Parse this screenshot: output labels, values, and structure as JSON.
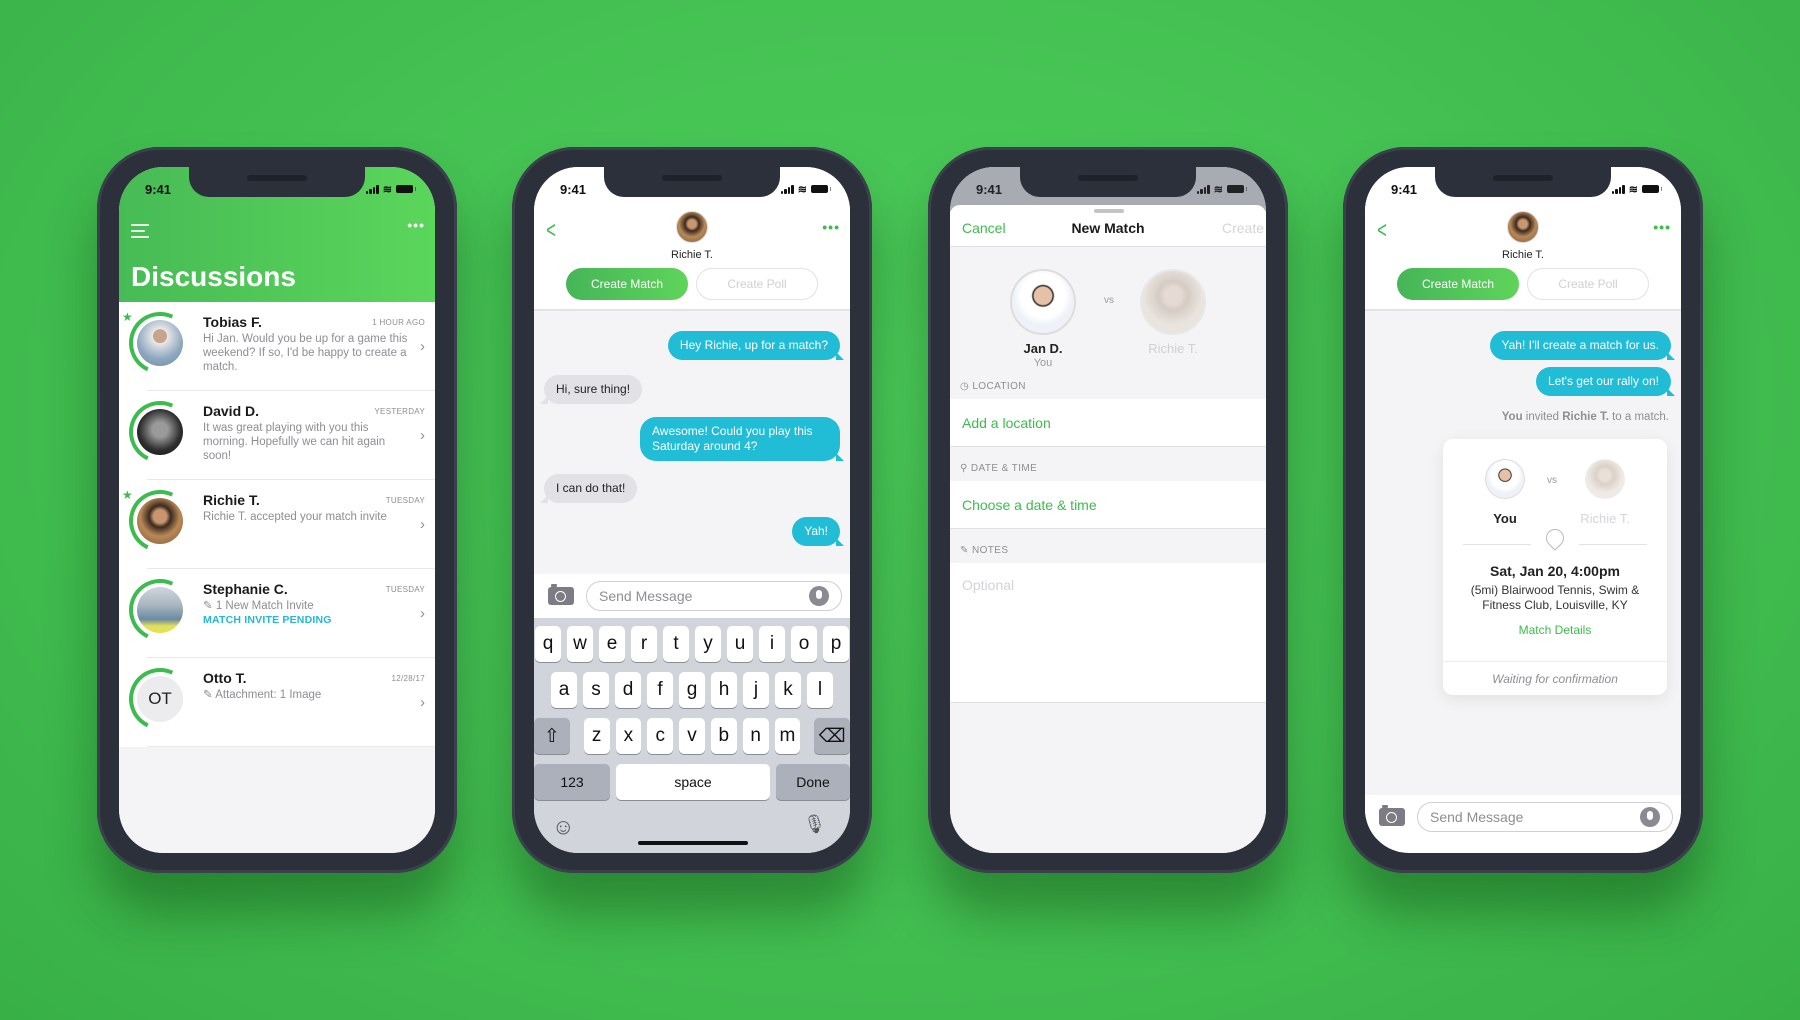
{
  "status": {
    "time": "9:41"
  },
  "discussions": {
    "title": "Discussions",
    "items": [
      {
        "name": "Tobias F.",
        "time": "1 HOUR AGO",
        "message": "Hi Jan. Would you be up for a game this weekend? If so, I'd be happy to create a match.",
        "starred": true
      },
      {
        "name": "David D.",
        "time": "YESTERDAY",
        "message": "It was great playing with you this morning. Hopefully we can hit again soon!",
        "starred": false
      },
      {
        "name": "Richie T.",
        "time": "TUESDAY",
        "message": "Richie T. accepted your match invite",
        "starred": true
      },
      {
        "name": "Stephanie C.",
        "time": "TUESDAY",
        "message": "1 New Match Invite",
        "status": "MATCH INVITE PENDING",
        "starred": false
      },
      {
        "name": "Otto T.",
        "initials": "OT",
        "time": "12/28/17",
        "message": "Attachment: 1 Image",
        "starred": false
      }
    ]
  },
  "chat": {
    "contact": "Richie T.",
    "create_match": "Create Match",
    "create_poll": "Create Poll",
    "messages": [
      {
        "dir": "out",
        "text": "Hey Richie, up for a match?"
      },
      {
        "dir": "in",
        "text": "Hi, sure thing!"
      },
      {
        "dir": "out",
        "text": "Awesome! Could you play this Saturday around 4?"
      },
      {
        "dir": "in",
        "text": "I can do that!"
      },
      {
        "dir": "out",
        "text": "Yah!"
      }
    ],
    "input_placeholder": "Send Message",
    "keyboard": {
      "row1": [
        "q",
        "w",
        "e",
        "r",
        "t",
        "y",
        "u",
        "i",
        "o",
        "p"
      ],
      "row2": [
        "a",
        "s",
        "d",
        "f",
        "g",
        "h",
        "j",
        "k",
        "l"
      ],
      "row3": [
        "z",
        "x",
        "c",
        "v",
        "b",
        "n",
        "m"
      ],
      "numbers": "123",
      "space": "space",
      "done": "Done"
    }
  },
  "new_match": {
    "cancel": "Cancel",
    "title": "New Match",
    "create": "Create",
    "player1": {
      "name": "Jan D.",
      "sub": "You"
    },
    "vs": "vs",
    "player2": {
      "name": "Richie T."
    },
    "location_label": "LOCATION",
    "location_value": "Add a location",
    "datetime_label": "DATE & TIME",
    "datetime_value": "Choose a date & time",
    "notes_label": "NOTES",
    "notes_placeholder": "Optional"
  },
  "chat2": {
    "contact": "Richie T.",
    "create_match": "Create Match",
    "create_poll": "Create Poll",
    "messages": [
      {
        "dir": "out",
        "text": "Yah! I'll create a match for us."
      },
      {
        "dir": "out",
        "text": "Let's get our rally on!"
      }
    ],
    "system_you": "You",
    "system_mid": " invited ",
    "system_name": "Richie T.",
    "system_end": " to a match.",
    "card": {
      "player1": "You",
      "vs": "vs",
      "player2": "Richie T.",
      "datetime": "Sat, Jan 20, 4:00pm",
      "location": "(5mi) Blairwood Tennis, Swim & Fitness Club, Louisville, KY",
      "details_link": "Match Details",
      "status": "Waiting for confirmation"
    },
    "input_placeholder": "Send Message"
  }
}
